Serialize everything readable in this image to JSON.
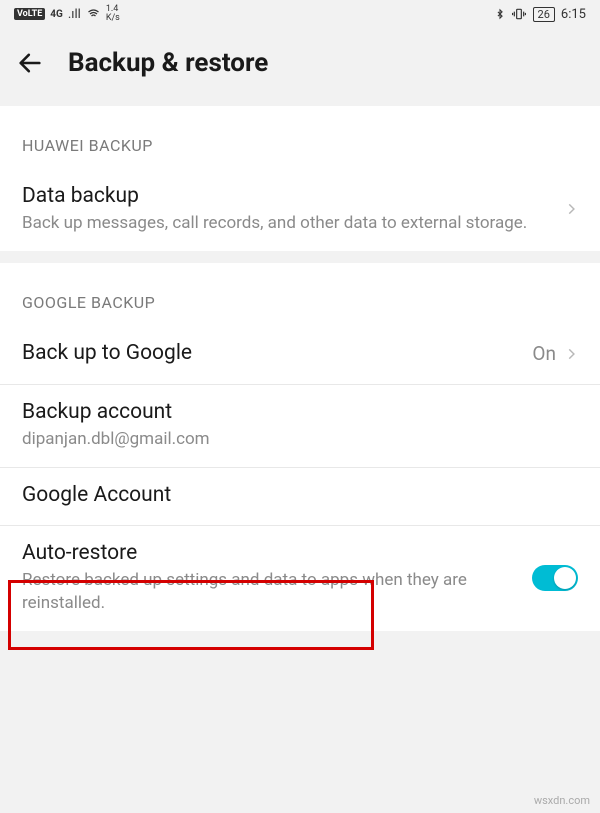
{
  "status_bar": {
    "volte": "VoLTE",
    "net": "4G",
    "signal_glyph": ".ıll",
    "wifi_glyph": "⟊",
    "speed_top": "1.4",
    "speed_bottom": "K/s",
    "bluetooth": "✱",
    "vibrate": "▯",
    "battery": "26",
    "time": "6:15"
  },
  "header": {
    "title": "Backup & restore"
  },
  "sections": {
    "s1_header": "HUAWEI BACKUP",
    "data_backup_title": "Data backup",
    "data_backup_sub": "Back up messages, call records, and other data to external storage.",
    "s2_header": "GOOGLE BACKUP",
    "backup_google_title": "Back up to Google",
    "backup_google_value": "On",
    "backup_account_title": "Backup account",
    "backup_account_sub": "dipanjan.dbl@gmail.com",
    "google_account_title": "Google Account",
    "auto_restore_title": "Auto-restore",
    "auto_restore_sub": "Restore backed up settings and data to apps when they are reinstalled."
  },
  "watermark": "wsxdn.com"
}
